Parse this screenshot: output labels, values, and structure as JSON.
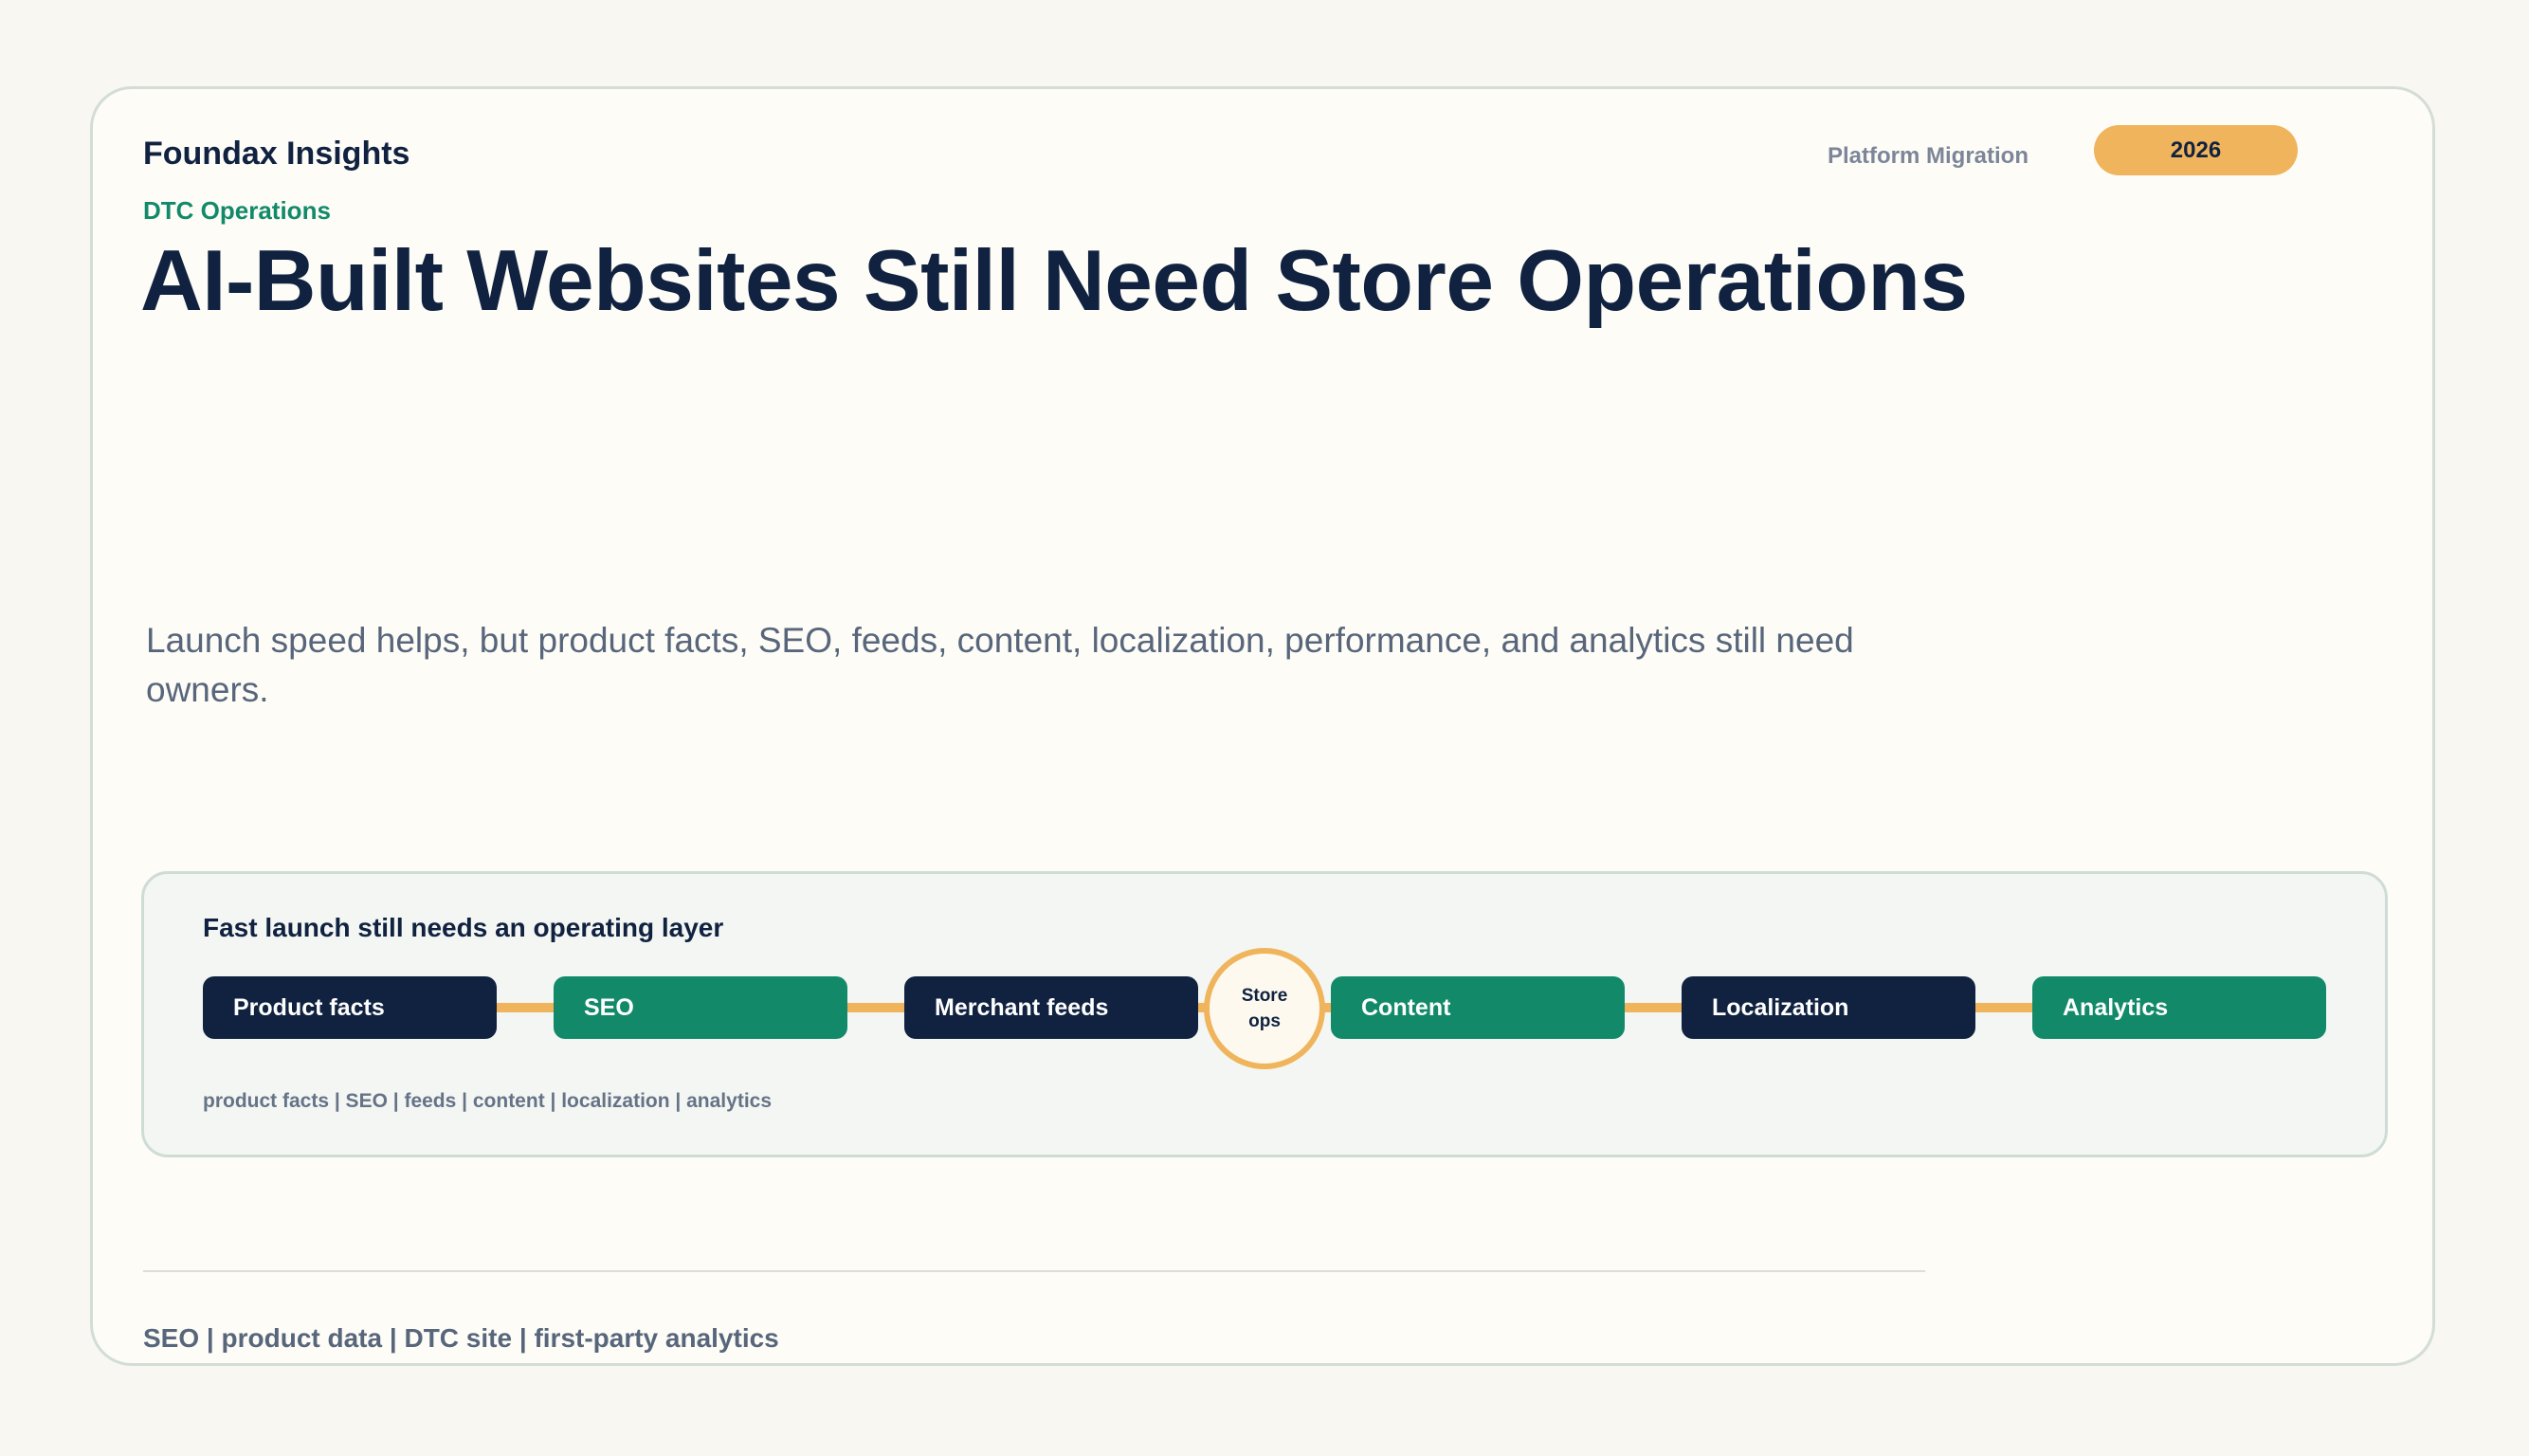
{
  "header": {
    "brand": "Foundax Insights",
    "section": "Platform Migration",
    "year": "2026",
    "eyebrow": "DTC Operations"
  },
  "headline": "AI-Built Websites Still Need Store Operations",
  "lede": "Launch speed helps, but product facts, SEO, feeds, content, localization, performance, and analytics still need owners.",
  "diagram": {
    "title": "Fast launch still needs an operating layer",
    "hub": {
      "line1": "Store",
      "line2": "ops"
    },
    "nodes": [
      {
        "label": "Product facts",
        "tone": "dark"
      },
      {
        "label": "SEO",
        "tone": "green"
      },
      {
        "label": "Merchant feeds",
        "tone": "dark"
      },
      {
        "label": "Content",
        "tone": "green"
      },
      {
        "label": "Localization",
        "tone": "dark"
      },
      {
        "label": "Analytics",
        "tone": "green"
      }
    ],
    "caption": "product facts | SEO | feeds | content | localization | analytics"
  },
  "footer": "SEO | product data | DTC site | first-party analytics",
  "colors": {
    "navy": "#102240",
    "green": "#128a6a",
    "amber": "#efb45c",
    "muted": "#58667b"
  }
}
